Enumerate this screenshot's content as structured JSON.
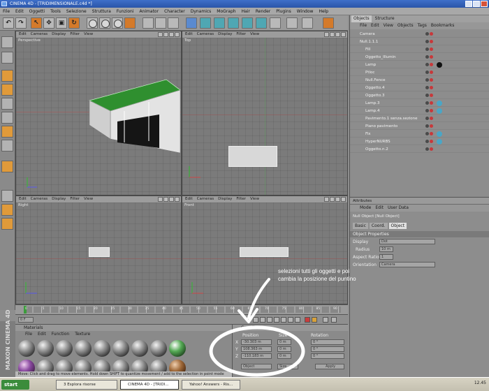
{
  "window": {
    "title": "CINEMA 4D - [TRIDIMENSIONALE.c4d *]"
  },
  "menubar": [
    "File",
    "Edit",
    "Oggetti",
    "Tools",
    "Selezione",
    "Struttura",
    "Funzioni",
    "Animator",
    "Character",
    "Dynamics",
    "MoGraph",
    "Hair",
    "Render",
    "Plugins",
    "Window",
    "Help"
  ],
  "viewports": {
    "menu": [
      "Edit",
      "Cameras",
      "Display",
      "Filter",
      "View"
    ],
    "perspective_title": "Perspective",
    "top_title": "Top",
    "right_title": "Right",
    "front_title": "Front"
  },
  "object_manager": {
    "tabs": [
      "Objects",
      "Structure"
    ],
    "menu": [
      "File",
      "Edit",
      "View",
      "Objects",
      "Tags",
      "Bookmarks"
    ],
    "rows": [
      "Camera",
      "Null.1.1.1",
      "Fill",
      "Oggetto_Illumin",
      "Lamp",
      "Ptloc",
      "Null.Fence",
      "Oggetto.4",
      "Oggetto.3",
      "Lamp.3",
      "Lamp.4",
      "Pavimento.1 senza.sezione",
      "Piano pavimento",
      "Fix",
      "HyperNURBS",
      "Oggetto.n.2"
    ]
  },
  "attribute_manager": {
    "title": "Attributes",
    "menu": [
      "Mode",
      "Edit",
      "User Data"
    ],
    "object_name": "Null Object [Null Object]",
    "tabs": [
      "Basic",
      "Coord.",
      "Object"
    ],
    "section": "Object Properties",
    "props": [
      {
        "label": "Display",
        "value": "Dot"
      },
      {
        "label": "Radius",
        "value": "10 m"
      },
      {
        "label": "Aspect Ratio",
        "value": "1"
      },
      {
        "label": "Orientation",
        "value": "Camera"
      }
    ]
  },
  "timeline": {
    "ticks": [
      "0",
      "5",
      "10",
      "15",
      "20",
      "25",
      "30",
      "35",
      "40",
      "45",
      "50",
      "55",
      "60",
      "65",
      "70",
      "75",
      "80",
      "85",
      "90"
    ],
    "frame": "0 F"
  },
  "materials": {
    "title": "Materials",
    "menu": [
      "File",
      "Edit",
      "Function",
      "Texture"
    ],
    "count": 18,
    "status": "Move: Click and drag to move elements. Hold down SHIFT to quantize movement / add to the selection in point mode"
  },
  "coordinates": {
    "title": "Coordinates",
    "headers": [
      "Position",
      "Size",
      "Rotation"
    ],
    "rows": [
      {
        "axis": "X",
        "pos": "-30.303 m",
        "size": "0 m",
        "rot": "0 °"
      },
      {
        "axis": "Y",
        "pos": "108.363 m",
        "size": "0 m",
        "rot": "0 °"
      },
      {
        "axis": "Z",
        "pos": "-110.183 m",
        "size": "0 m",
        "rot": "0 °"
      }
    ],
    "mode": "Object",
    "size_mode": "Size",
    "apply": "Apply"
  },
  "annotation": {
    "line1": "selezioni tutti gli oggetti e poi",
    "line2": "cambia la posizione del puntino"
  },
  "brand": "MAXON CINEMA 4D",
  "taskbar": {
    "start": "start",
    "tasks": [
      "3 Esplora risorse",
      "CINEMA 4D - [TRIDI...",
      "Yahoo! Answers - Ris..."
    ],
    "clock": "12.45"
  }
}
